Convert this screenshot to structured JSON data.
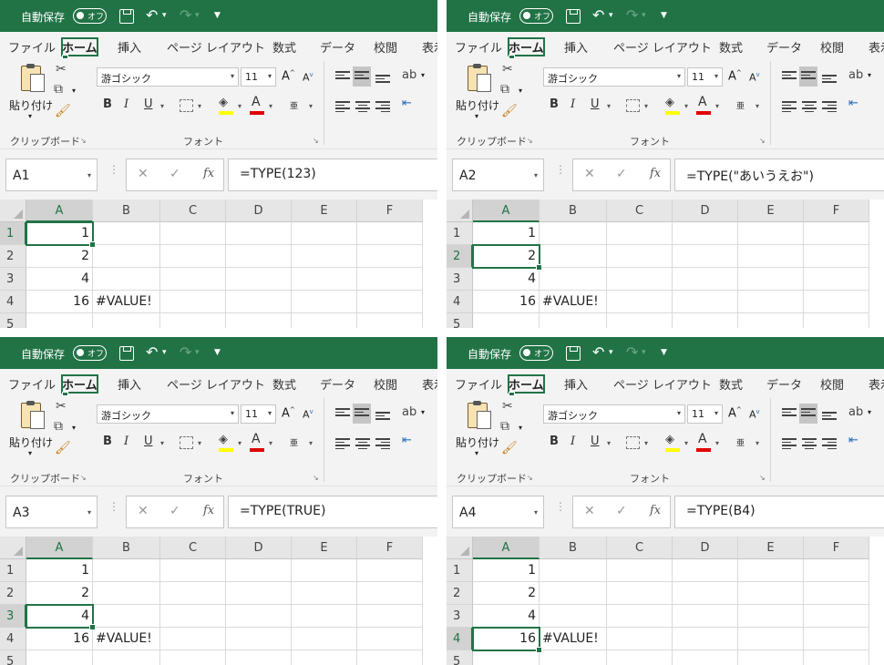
{
  "titlebar": {
    "autosave": "自動保存",
    "toggle": "オフ",
    "save": "save-icon",
    "undo": "↶",
    "redo": "↷",
    "more": "▼",
    "dropdown": "▾"
  },
  "tabs": [
    "ファイル",
    "ホーム",
    "挿入",
    "ページ レイアウト",
    "数式",
    "データ",
    "校閲",
    "表示"
  ],
  "active_tab": "ホーム",
  "ribbon": {
    "paste_label": "貼り付け",
    "clipboard_label": "クリップボード",
    "font_label": "フォント",
    "font_name": "游ゴシック",
    "font_size": "11",
    "bold": "B",
    "italic": "I",
    "underline": "U",
    "grow": "A",
    "shrink": "A",
    "font_color_letter": "A",
    "phonetic": "亜",
    "cut_icon": "scissors-icon",
    "copy_icon": "copy-icon",
    "painter_icon": "format-painter-icon",
    "group_corner": "↘",
    "dd": "▾"
  },
  "columns": [
    "A",
    "B",
    "C",
    "D",
    "E",
    "F"
  ],
  "rows": [
    "1",
    "2",
    "3",
    "4",
    "5"
  ],
  "cells": {
    "A": [
      "1",
      "2",
      "4",
      "16",
      ""
    ],
    "B": [
      "",
      "",
      "",
      "#VALUE!",
      ""
    ]
  },
  "formula_buttons": {
    "cancel": "✕",
    "enter": "✓",
    "fx": "fx",
    "dots": "⋮"
  },
  "panels": [
    {
      "name_box": "A1",
      "formula": "=TYPE(123)",
      "active_row": 0
    },
    {
      "name_box": "A2",
      "formula": "=TYPE(\"あいうえお\")",
      "active_row": 1
    },
    {
      "name_box": "A3",
      "formula": "=TYPE(TRUE)",
      "active_row": 2
    },
    {
      "name_box": "A4",
      "formula": "=TYPE(B4)",
      "active_row": 3
    }
  ]
}
